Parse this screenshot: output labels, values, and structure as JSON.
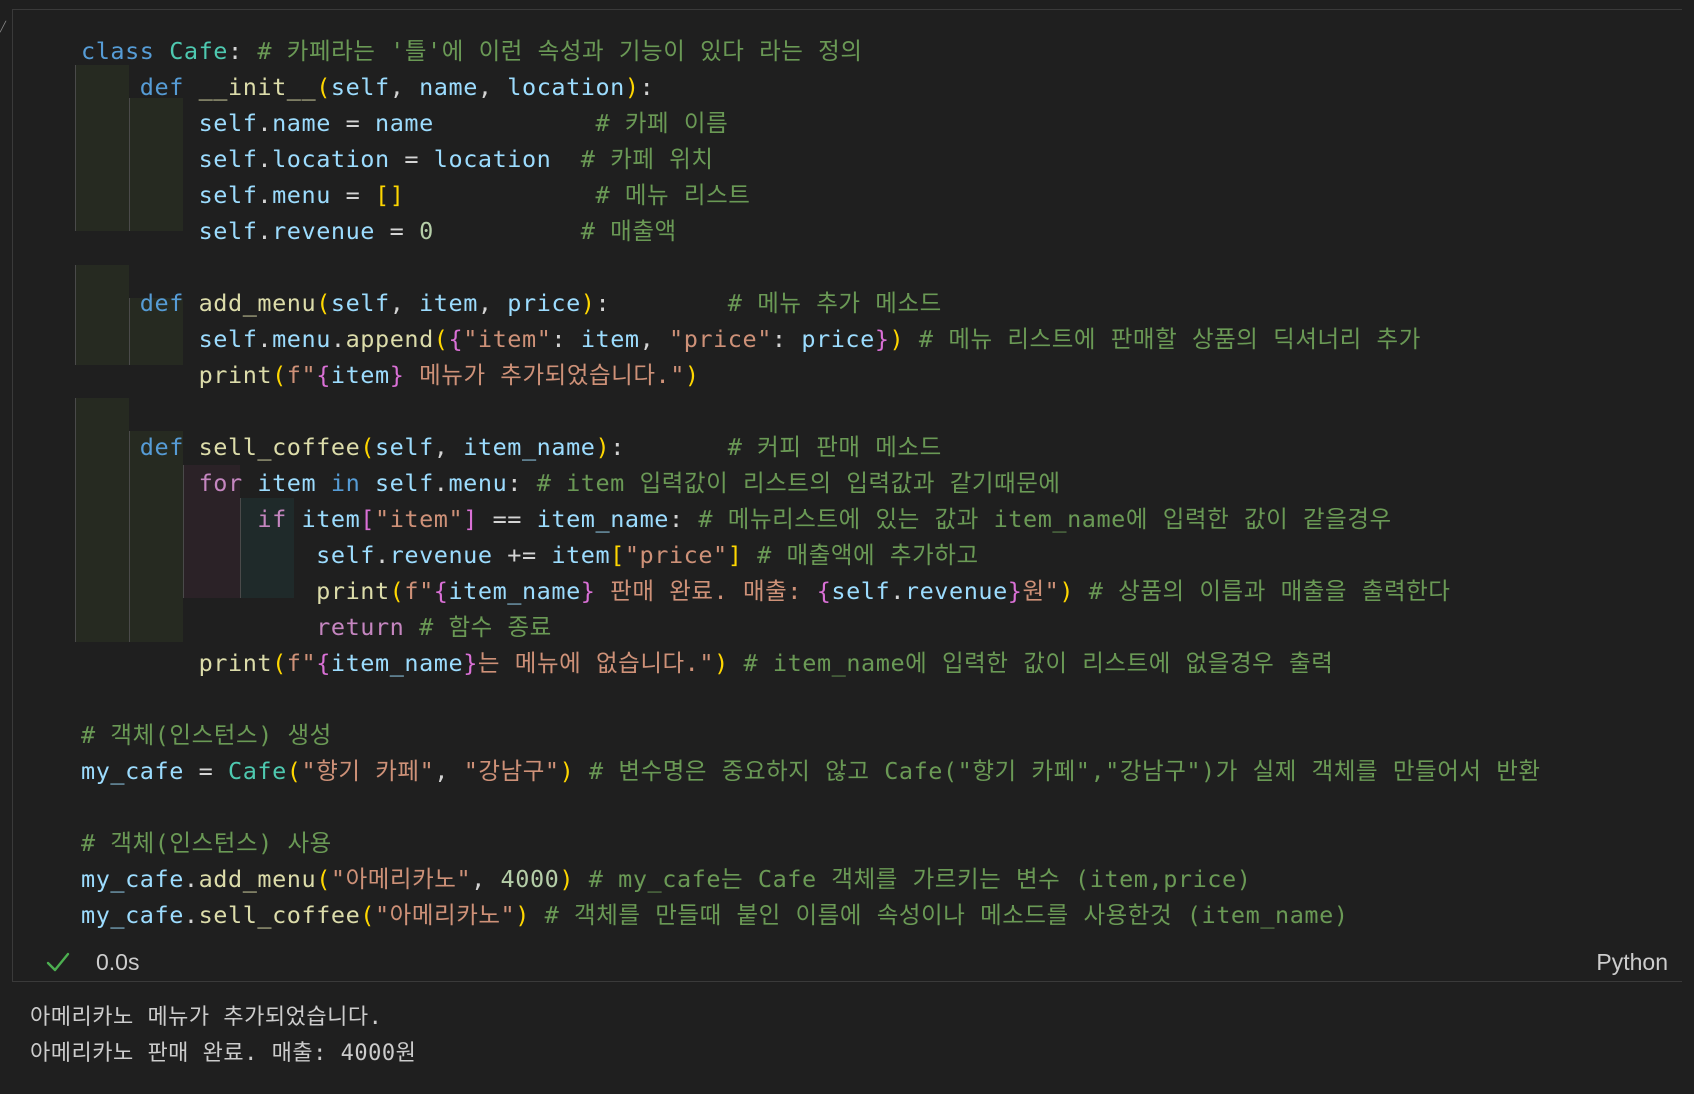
{
  "cell": {
    "language": "Python",
    "exec_time": "0.0s",
    "status_icon": "checkmark-icon",
    "code_lines": [
      [
        {
          "t": "class ",
          "c": "kw-blue"
        },
        {
          "t": "Cafe",
          "c": "cls"
        },
        {
          "t": ": "
        },
        {
          "t": "# 카페라는 '틀'에 이런 속성과 기능이 있다 라는 정의",
          "c": "cm"
        }
      ],
      [
        {
          "t": "    "
        },
        {
          "t": "def ",
          "c": "kw-blue"
        },
        {
          "t": "__init__",
          "c": "fn"
        },
        {
          "t": "(",
          "c": "b1"
        },
        {
          "t": "self",
          "c": "var"
        },
        {
          "t": ", "
        },
        {
          "t": "name",
          "c": "var"
        },
        {
          "t": ", "
        },
        {
          "t": "location",
          "c": "var"
        },
        {
          "t": ")",
          "c": "b1"
        },
        {
          "t": ":"
        }
      ],
      [
        {
          "t": "        "
        },
        {
          "t": "self",
          "c": "var"
        },
        {
          "t": "."
        },
        {
          "t": "name",
          "c": "var"
        },
        {
          "t": " = "
        },
        {
          "t": "name",
          "c": "var"
        },
        {
          "t": "           "
        },
        {
          "t": "# 카페 이름",
          "c": "cm"
        }
      ],
      [
        {
          "t": "        "
        },
        {
          "t": "self",
          "c": "var"
        },
        {
          "t": "."
        },
        {
          "t": "location",
          "c": "var"
        },
        {
          "t": " = "
        },
        {
          "t": "location",
          "c": "var"
        },
        {
          "t": "  "
        },
        {
          "t": "# 카페 위치",
          "c": "cm"
        }
      ],
      [
        {
          "t": "        "
        },
        {
          "t": "self",
          "c": "var"
        },
        {
          "t": "."
        },
        {
          "t": "menu",
          "c": "var"
        },
        {
          "t": " = "
        },
        {
          "t": "[]",
          "c": "b1"
        },
        {
          "t": "             "
        },
        {
          "t": "# 메뉴 리스트",
          "c": "cm"
        }
      ],
      [
        {
          "t": "        "
        },
        {
          "t": "self",
          "c": "var"
        },
        {
          "t": "."
        },
        {
          "t": "revenue",
          "c": "var"
        },
        {
          "t": " = "
        },
        {
          "t": "0",
          "c": "num"
        },
        {
          "t": "          "
        },
        {
          "t": "# 매출액",
          "c": "cm"
        }
      ],
      [
        {
          "t": ""
        }
      ],
      [
        {
          "t": "    "
        },
        {
          "t": "def ",
          "c": "kw-blue"
        },
        {
          "t": "add_menu",
          "c": "fn"
        },
        {
          "t": "(",
          "c": "b1"
        },
        {
          "t": "self",
          "c": "var"
        },
        {
          "t": ", "
        },
        {
          "t": "item",
          "c": "var"
        },
        {
          "t": ", "
        },
        {
          "t": "price",
          "c": "var"
        },
        {
          "t": ")",
          "c": "b1"
        },
        {
          "t": ":        "
        },
        {
          "t": "# 메뉴 추가 메소드",
          "c": "cm"
        }
      ],
      [
        {
          "t": "        "
        },
        {
          "t": "self",
          "c": "var"
        },
        {
          "t": "."
        },
        {
          "t": "menu",
          "c": "var"
        },
        {
          "t": "."
        },
        {
          "t": "append",
          "c": "fn"
        },
        {
          "t": "(",
          "c": "b1"
        },
        {
          "t": "{",
          "c": "b2"
        },
        {
          "t": "\"item\"",
          "c": "str"
        },
        {
          "t": ": "
        },
        {
          "t": "item",
          "c": "var"
        },
        {
          "t": ", "
        },
        {
          "t": "\"price\"",
          "c": "str"
        },
        {
          "t": ": "
        },
        {
          "t": "price",
          "c": "var"
        },
        {
          "t": "}",
          "c": "b2"
        },
        {
          "t": ")",
          "c": "b1"
        },
        {
          "t": " "
        },
        {
          "t": "# 메뉴 리스트에 판매할 상품의 딕셔너리 추가",
          "c": "cm"
        }
      ],
      [
        {
          "t": "        "
        },
        {
          "t": "print",
          "c": "fn"
        },
        {
          "t": "(",
          "c": "b1"
        },
        {
          "t": "f\"",
          "c": "str"
        },
        {
          "t": "{",
          "c": "b2"
        },
        {
          "t": "item",
          "c": "var"
        },
        {
          "t": "}",
          "c": "b2"
        },
        {
          "t": " 메뉴가 추가되었습니다.\"",
          "c": "str"
        },
        {
          "t": ")",
          "c": "b1"
        }
      ],
      [
        {
          "t": ""
        }
      ],
      [
        {
          "t": "    "
        },
        {
          "t": "def ",
          "c": "kw-blue"
        },
        {
          "t": "sell_coffee",
          "c": "fn"
        },
        {
          "t": "(",
          "c": "b1"
        },
        {
          "t": "self",
          "c": "var"
        },
        {
          "t": ", "
        },
        {
          "t": "item_name",
          "c": "var"
        },
        {
          "t": ")",
          "c": "b1"
        },
        {
          "t": ":       "
        },
        {
          "t": "# 커피 판매 메소드",
          "c": "cm"
        }
      ],
      [
        {
          "t": "        "
        },
        {
          "t": "for ",
          "c": "kw-pink"
        },
        {
          "t": "item",
          "c": "var"
        },
        {
          "t": " in ",
          "c": "kw-blue"
        },
        {
          "t": "self",
          "c": "var"
        },
        {
          "t": "."
        },
        {
          "t": "menu",
          "c": "var"
        },
        {
          "t": ": "
        },
        {
          "t": "# item 입력값이 리스트의 입력값과 같기때문에",
          "c": "cm"
        }
      ],
      [
        {
          "t": "            "
        },
        {
          "t": "if ",
          "c": "kw-pink"
        },
        {
          "t": "item",
          "c": "var"
        },
        {
          "t": "[",
          "c": "b2"
        },
        {
          "t": "\"item\"",
          "c": "str"
        },
        {
          "t": "]",
          "c": "b2"
        },
        {
          "t": " == "
        },
        {
          "t": "item_name",
          "c": "var"
        },
        {
          "t": ": "
        },
        {
          "t": "# 메뉴리스트에 있는 값과 item_name에 입력한 값이 같을경우",
          "c": "cm"
        }
      ],
      [
        {
          "t": "                "
        },
        {
          "t": "self",
          "c": "var"
        },
        {
          "t": "."
        },
        {
          "t": "revenue",
          "c": "var"
        },
        {
          "t": " += "
        },
        {
          "t": "item",
          "c": "var"
        },
        {
          "t": "[",
          "c": "b1"
        },
        {
          "t": "\"price\"",
          "c": "str"
        },
        {
          "t": "]",
          "c": "b1"
        },
        {
          "t": " "
        },
        {
          "t": "# 매출액에 추가하고",
          "c": "cm"
        }
      ],
      [
        {
          "t": "                "
        },
        {
          "t": "print",
          "c": "fn"
        },
        {
          "t": "(",
          "c": "b1"
        },
        {
          "t": "f\"",
          "c": "str"
        },
        {
          "t": "{",
          "c": "b2"
        },
        {
          "t": "item_name",
          "c": "var"
        },
        {
          "t": "}",
          "c": "b2"
        },
        {
          "t": " 판매 완료. 매출: ",
          "c": "str"
        },
        {
          "t": "{",
          "c": "b2"
        },
        {
          "t": "self",
          "c": "var"
        },
        {
          "t": "."
        },
        {
          "t": "revenue",
          "c": "var"
        },
        {
          "t": "}",
          "c": "b2"
        },
        {
          "t": "원\"",
          "c": "str"
        },
        {
          "t": ")",
          "c": "b1"
        },
        {
          "t": " "
        },
        {
          "t": "# 상품의 이름과 매출을 출력한다",
          "c": "cm"
        }
      ],
      [
        {
          "t": "                "
        },
        {
          "t": "return ",
          "c": "kw-pink"
        },
        {
          "t": "# 함수 종료",
          "c": "cm"
        }
      ],
      [
        {
          "t": "        "
        },
        {
          "t": "print",
          "c": "fn"
        },
        {
          "t": "(",
          "c": "b1"
        },
        {
          "t": "f\"",
          "c": "str"
        },
        {
          "t": "{",
          "c": "b2"
        },
        {
          "t": "item_name",
          "c": "var"
        },
        {
          "t": "}",
          "c": "b2"
        },
        {
          "t": "는 메뉴에 없습니다.\"",
          "c": "str"
        },
        {
          "t": ")",
          "c": "b1"
        },
        {
          "t": " "
        },
        {
          "t": "# item_name에 입력한 값이 리스트에 없을경우 출력",
          "c": "cm"
        }
      ],
      [
        {
          "t": ""
        }
      ],
      [
        {
          "t": "# 객체(인스턴스) 생성",
          "c": "cm"
        }
      ],
      [
        {
          "t": "my_cafe",
          "c": "var"
        },
        {
          "t": " = "
        },
        {
          "t": "Cafe",
          "c": "cls"
        },
        {
          "t": "(",
          "c": "b1"
        },
        {
          "t": "\"향기 카페\"",
          "c": "str"
        },
        {
          "t": ", "
        },
        {
          "t": "\"강남구\"",
          "c": "str"
        },
        {
          "t": ")",
          "c": "b1"
        },
        {
          "t": " "
        },
        {
          "t": "# 변수명은 중요하지 않고 Cafe(\"향기 카페\",\"강남구\")가 실제 객체를 만들어서 반환",
          "c": "cm"
        }
      ],
      [
        {
          "t": ""
        }
      ],
      [
        {
          "t": "# 객체(인스턴스) 사용",
          "c": "cm"
        }
      ],
      [
        {
          "t": "my_cafe",
          "c": "var"
        },
        {
          "t": "."
        },
        {
          "t": "add_menu",
          "c": "fn"
        },
        {
          "t": "(",
          "c": "b1"
        },
        {
          "t": "\"아메리카노\"",
          "c": "str"
        },
        {
          "t": ", "
        },
        {
          "t": "4000",
          "c": "num"
        },
        {
          "t": ")",
          "c": "b1"
        },
        {
          "t": " "
        },
        {
          "t": "# my_cafe는 Cafe 객체를 가르키는 변수 (item,price)",
          "c": "cm"
        }
      ],
      [
        {
          "t": "my_cafe",
          "c": "var"
        },
        {
          "t": "."
        },
        {
          "t": "sell_coffee",
          "c": "fn"
        },
        {
          "t": "(",
          "c": "b1"
        },
        {
          "t": "\"아메리카노\"",
          "c": "str"
        },
        {
          "t": ")",
          "c": "b1"
        },
        {
          "t": " "
        },
        {
          "t": "# 객체를 만들때 붙인 이름에 속성이나 메소드를 사용한것 (item_name)",
          "c": "cm"
        }
      ]
    ]
  },
  "output": {
    "lines": [
      "아메리카노 메뉴가 추가되었습니다.",
      "아메리카노 판매 완료. 매출: 4000원"
    ]
  },
  "colors": {
    "background": "#1f1f1f",
    "keyword": "#569cd6",
    "class": "#4ec9b0",
    "comment": "#6a9955",
    "variable": "#9cdcfe",
    "function": "#dcdcaa",
    "string": "#ce9178",
    "number": "#b5cea8",
    "control": "#c586c0",
    "bracket1": "#ffd700",
    "bracket2": "#da70d6"
  }
}
